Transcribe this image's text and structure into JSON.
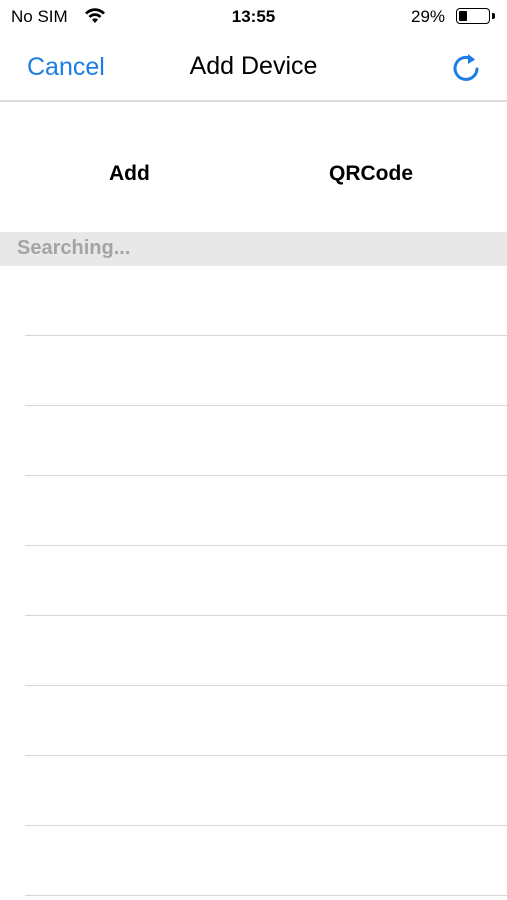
{
  "status_bar": {
    "carrier": "No SIM",
    "time": "13:55",
    "battery_percent": "29%",
    "battery_level": 0.29,
    "wifi_icon": "wifi-icon"
  },
  "nav": {
    "cancel_label": "Cancel",
    "title": "Add Device",
    "refresh_icon": "refresh-icon",
    "accent_color": "#1a7ee6"
  },
  "tabs": [
    {
      "label": "Add"
    },
    {
      "label": "QRCode"
    }
  ],
  "section": {
    "header": "Searching..."
  },
  "device_list": {
    "row_count": 9
  }
}
